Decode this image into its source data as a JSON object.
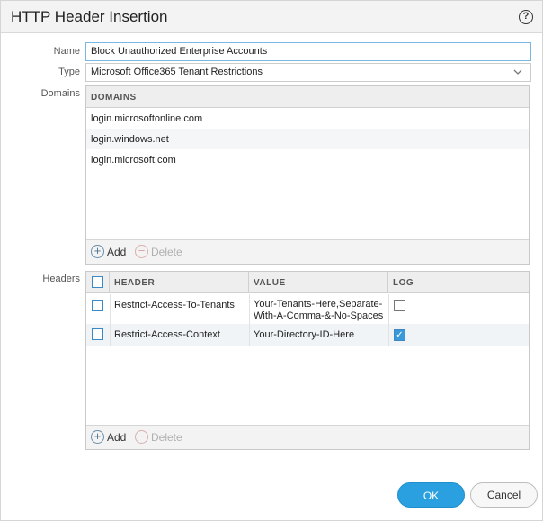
{
  "dialog": {
    "title": "HTTP Header Insertion",
    "help_icon": "?"
  },
  "form": {
    "name_label": "Name",
    "name_value": "Block Unauthorized Enterprise Accounts",
    "type_label": "Type",
    "type_value": "Microsoft Office365 Tenant Restrictions",
    "domains_label": "Domains",
    "headers_label": "Headers"
  },
  "domains": {
    "column": "DOMAINS",
    "rows": [
      "login.microsoftonline.com",
      "login.windows.net",
      "login.microsoft.com"
    ],
    "add_label": "Add",
    "delete_label": "Delete"
  },
  "headers": {
    "columns": {
      "header": "HEADER",
      "value": "VALUE",
      "log": "LOG"
    },
    "rows": [
      {
        "header": "Restrict-Access-To-Tenants",
        "value_line1": "Your-Tenants-Here,Separate-",
        "value_line2": "With-A-Comma-&-No-Spaces",
        "log": false
      },
      {
        "header": "Restrict-Access-Context",
        "value_line1": "Your-Directory-ID-Here",
        "value_line2": "",
        "log": true
      }
    ],
    "add_label": "Add",
    "delete_label": "Delete"
  },
  "buttons": {
    "ok": "OK",
    "cancel": "Cancel"
  },
  "colors": {
    "accent": "#2aa0e0",
    "focus_border": "#7ab7e2"
  }
}
